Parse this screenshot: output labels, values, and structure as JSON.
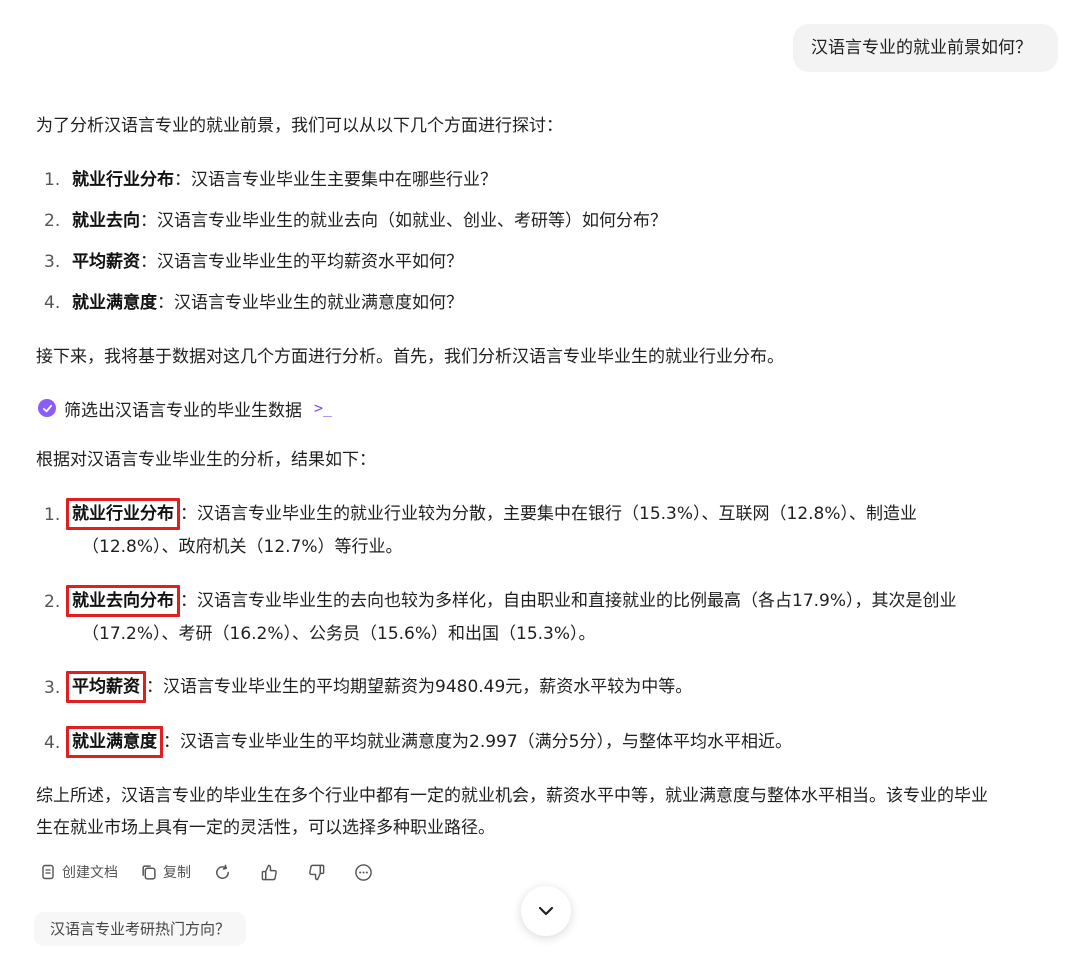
{
  "user_message": "汉语言专业的就业前景如何？",
  "intro": "为了分析汉语言专业的就业前景，我们可以从以下几个方面进行探讨：",
  "plan_items": [
    {
      "num": "1.",
      "bold": "就业行业分布",
      "text": "：汉语言专业毕业生主要集中在哪些行业？"
    },
    {
      "num": "2.",
      "bold": "就业去向",
      "text": "：汉语言专业毕业生的就业去向（如就业、创业、考研等）如何分布？"
    },
    {
      "num": "3.",
      "bold": "平均薪资",
      "text": "：汉语言专业毕业生的平均薪资水平如何？"
    },
    {
      "num": "4.",
      "bold": "就业满意度",
      "text": "：汉语言专业毕业生的就业满意度如何？"
    }
  ],
  "next_step": "接下来，我将基于数据对这几个方面进行分析。首先，我们分析汉语言专业毕业生的就业行业分布。",
  "tool_call": {
    "label": "筛选出汉语言专业的毕业生数据",
    "icon": "check-icon",
    "terminal_icon": "terminal-icon"
  },
  "result_intro": "根据对汉语言专业毕业生的分析，结果如下：",
  "results": [
    {
      "num": "1.",
      "bold": "就业行业分布",
      "line1": "：汉语言专业毕业生的就业行业较为分散，主要集中在银行（15.3%）、互联网（12.8%）、制造业",
      "line2": "（12.8%）、政府机关（12.7%）等行业。"
    },
    {
      "num": "2.",
      "bold": "就业去向分布",
      "line1": "：汉语言专业毕业生的去向也较为多样化，自由职业和直接就业的比例最高（各占17.9%），其次是创业",
      "line2": "（17.2%）、考研（16.2%）、公务员（15.6%）和出国（15.3%）。"
    },
    {
      "num": "3.",
      "bold": "平均薪资",
      "line1": "：汉语言专业毕业生的平均期望薪资为9480.49元，薪资水平较为中等。",
      "line2": ""
    },
    {
      "num": "4.",
      "bold": "就业满意度",
      "line1": "：汉语言专业毕业生的平均就业满意度为2.997（满分5分），与整体平均水平相近。",
      "line2": ""
    }
  ],
  "summary": {
    "line1": "综上所述，汉语言专业的毕业生在多个行业中都有一定的就业机会，薪资水平中等，就业满意度与整体水平相当。该专业的毕业",
    "line2": "生在就业市场上具有一定的灵活性，可以选择多种职业路径。"
  },
  "actions": {
    "create_doc": "创建文档",
    "copy": "复制",
    "regenerate_icon": "refresh-icon",
    "like_icon": "thumbs-up-icon",
    "dislike_icon": "thumbs-down-icon",
    "more_icon": "more-icon"
  },
  "suggestion": "汉语言专业考研热门方向？",
  "colors": {
    "highlight_box": "#e02020",
    "tool_accent": "#8b5cf6"
  }
}
